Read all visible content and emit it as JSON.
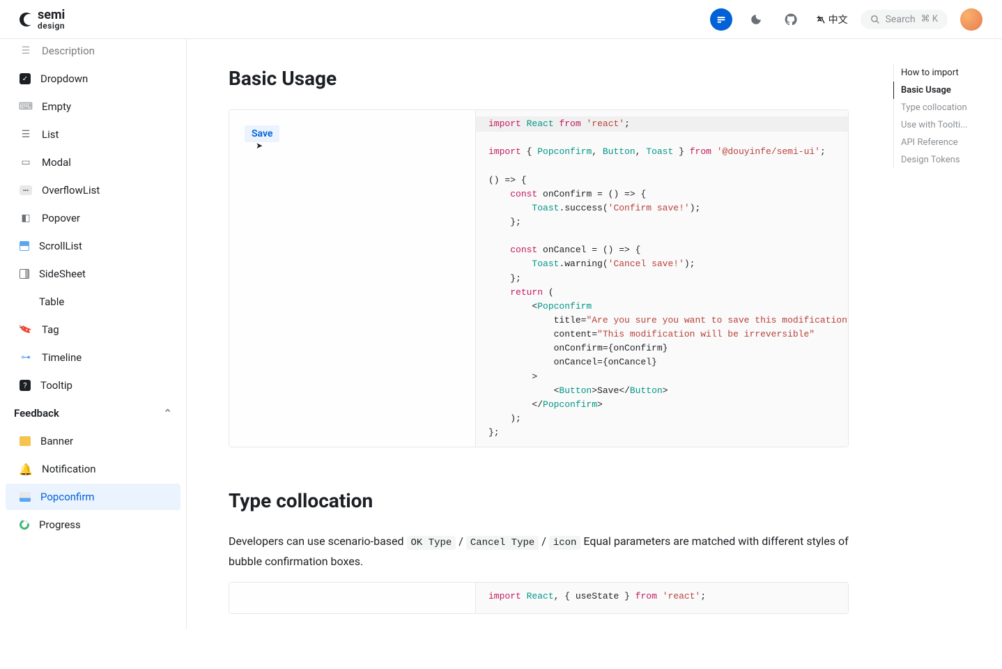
{
  "header": {
    "logo_top": "semi",
    "logo_bottom": "design",
    "lang_label": "中文",
    "search_label": "Search",
    "search_shortcut": "⌘ K"
  },
  "sidebar": {
    "items": [
      {
        "icon": "desc",
        "label": "Description"
      },
      {
        "icon": "dropdown",
        "label": "Dropdown"
      },
      {
        "icon": "empty",
        "label": "Empty"
      },
      {
        "icon": "list",
        "label": "List"
      },
      {
        "icon": "modal",
        "label": "Modal"
      },
      {
        "icon": "overflow",
        "label": "OverflowList"
      },
      {
        "icon": "popover",
        "label": "Popover"
      },
      {
        "icon": "scroll",
        "label": "ScrollList"
      },
      {
        "icon": "sidesheet",
        "label": "SideSheet"
      },
      {
        "icon": "table",
        "label": "Table"
      },
      {
        "icon": "tag",
        "label": "Tag"
      },
      {
        "icon": "timeline",
        "label": "Timeline"
      },
      {
        "icon": "tooltip",
        "label": "Tooltip"
      }
    ],
    "group_feedback": "Feedback",
    "feedback_items": [
      {
        "icon": "banner",
        "label": "Banner"
      },
      {
        "icon": "notif",
        "label": "Notification"
      },
      {
        "icon": "popconfirm",
        "label": "Popconfirm",
        "active": true
      },
      {
        "icon": "progress",
        "label": "Progress"
      }
    ]
  },
  "sections": {
    "basic_usage_title": "Basic Usage",
    "save_button": "Save",
    "type_collocation_title": "Type collocation",
    "type_collocation_text_1": "Developers can use scenario-based ",
    "code_ok": "OK Type",
    "slash1": " / ",
    "code_cancel": "Cancel Type",
    "slash2": " / ",
    "code_icon": "icon",
    "type_collocation_text_2": " Equal parameters are matched with different styles of bubble confirmation boxes."
  },
  "code": {
    "l1_import": "import",
    "l1_react": "React",
    "l1_from": "from",
    "l1_str": "'react'",
    "l1_semi": ";",
    "l2_import": "import",
    "l2_brace": "{ ",
    "l2_pop": "Popconfirm",
    "l2_c1": ", ",
    "l2_btn": "Button",
    "l2_c2": ", ",
    "l2_toast": "Toast",
    "l2_brace2": " }",
    "l2_from": "from",
    "l2_pkg": "'@douyinfe/semi-ui'",
    "l2_semi": ";",
    "l4": "() => {",
    "l5_const": "const",
    "l5_rest": " onConfirm = () => {",
    "l6_toast": "Toast",
    "l6_rest": ".success(",
    "l6_str": "'Confirm save!'",
    "l6_end": ");",
    "l7": "    };",
    "l9_const": "const",
    "l9_rest": " onCancel = () => {",
    "l10_toast": "Toast",
    "l10_rest": ".warning(",
    "l10_str": "'Cancel save!'",
    "l10_end": ");",
    "l11": "    };",
    "l12_return": "return",
    "l12_paren": " (",
    "l13_lt": "        <",
    "l13_tag": "Popconfirm",
    "l14_attr": "            title=",
    "l14_str": "\"Are you sure you want to save this modification?\"",
    "l15_attr": "            content=",
    "l15_str": "\"This modification will be irreversible\"",
    "l16": "            onConfirm={onConfirm}",
    "l17": "            onCancel={onCancel}",
    "l18": "        >",
    "l19_lt": "            <",
    "l19_btn": "Button",
    "l19_gt": ">",
    "l19_save": "Save",
    "l19_lt2": "</",
    "l19_btn2": "Button",
    "l19_gt2": ">",
    "l20_lt": "        </",
    "l20_tag": "Popconfirm",
    "l20_gt": ">",
    "l21": "    );",
    "l22": "};",
    "snippet2_import": "import",
    "snippet2_react": "React",
    "snippet2_c": ", { ",
    "snippet2_use": "useState",
    "snippet2_brace": " } ",
    "snippet2_from": "from",
    "snippet2_str": "'react'",
    "snippet2_semi": ";"
  },
  "toc": {
    "items": [
      {
        "label": "How to import"
      },
      {
        "label": "Basic Usage",
        "active": true
      },
      {
        "label": "Type collocation"
      },
      {
        "label": "Use with Toolti..."
      },
      {
        "label": "API Reference"
      },
      {
        "label": "Design Tokens"
      }
    ]
  }
}
